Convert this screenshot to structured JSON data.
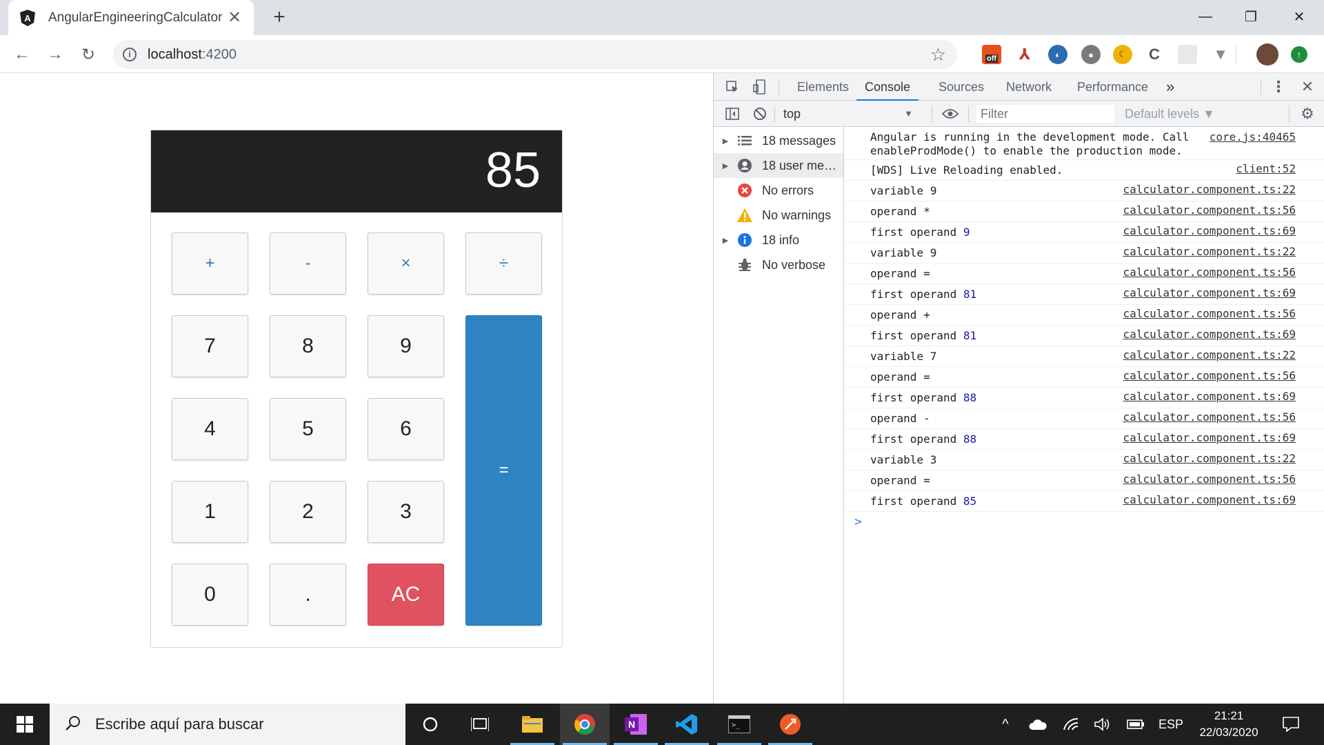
{
  "browser": {
    "tab_title": "AngularEngineeringCalculator",
    "url_host": "localhost",
    "url_port": ":4200",
    "extensions": [
      {
        "icon": "adblock-off-icon",
        "label": "off",
        "color": "#e8501a"
      },
      {
        "icon": "pdf-icon",
        "label": "",
        "color": "#c0392b"
      },
      {
        "icon": "opera-icon",
        "label": "",
        "color": "#2b6cb0"
      },
      {
        "icon": "tomato-icon",
        "label": "",
        "color": "#6b6b6b"
      },
      {
        "icon": "moon-icon",
        "label": "",
        "color": "#f0b400"
      },
      {
        "icon": "c-icon",
        "label": "",
        "color": "#555555"
      },
      {
        "icon": "blank-extension-icon",
        "label": "",
        "color": "#e0e0e0"
      },
      {
        "icon": "vee-icon",
        "label": "",
        "color": "#8a8a8a"
      }
    ]
  },
  "calculator": {
    "display": "85",
    "keys": {
      "plus": "+",
      "minus": "-",
      "times": "×",
      "divide": "÷",
      "k7": "7",
      "k8": "8",
      "k9": "9",
      "k4": "4",
      "k5": "5",
      "k6": "6",
      "k1": "1",
      "k2": "2",
      "k3": "3",
      "k0": "0",
      "dot": ".",
      "ac": "AC",
      "equals": "="
    }
  },
  "devtools": {
    "tabs": [
      "Elements",
      "Console",
      "Sources",
      "Network",
      "Performance"
    ],
    "more": "»",
    "context": "top",
    "filter_placeholder": "Filter",
    "levels": "Default levels ▼",
    "sidebar": [
      {
        "label": "18 messages",
        "icon": "list-icon",
        "expandable": true
      },
      {
        "label": "18 user mes...",
        "icon": "user-icon",
        "expandable": true
      },
      {
        "label": "No errors",
        "icon": "error-icon",
        "expandable": false
      },
      {
        "label": "No warnings",
        "icon": "warning-icon",
        "expandable": false
      },
      {
        "label": "18 info",
        "icon": "info-icon",
        "expandable": true
      },
      {
        "label": "No verbose",
        "icon": "bug-icon",
        "expandable": false
      }
    ],
    "messages": [
      {
        "line1": "Angular is running in the development mode. Call",
        "line2": "enableProdMode() to enable the production mode.",
        "num": "",
        "source": "core.js:40465"
      },
      {
        "line1": "[WDS] Live Reloading enabled.",
        "line2": "",
        "num": "",
        "source": "client:52"
      },
      {
        "line1": "variable 9",
        "line2": "",
        "num": "",
        "source": "calculator.component.ts:22"
      },
      {
        "line1": "operand *",
        "line2": "",
        "num": "",
        "source": "calculator.component.ts:56"
      },
      {
        "line1": "first operand ",
        "line2": "",
        "num": "9",
        "source": "calculator.component.ts:69"
      },
      {
        "line1": "variable 9",
        "line2": "",
        "num": "",
        "source": "calculator.component.ts:22"
      },
      {
        "line1": "operand =",
        "line2": "",
        "num": "",
        "source": "calculator.component.ts:56"
      },
      {
        "line1": "first operand ",
        "line2": "",
        "num": "81",
        "source": "calculator.component.ts:69"
      },
      {
        "line1": "operand +",
        "line2": "",
        "num": "",
        "source": "calculator.component.ts:56"
      },
      {
        "line1": "first operand ",
        "line2": "",
        "num": "81",
        "source": "calculator.component.ts:69"
      },
      {
        "line1": "variable 7",
        "line2": "",
        "num": "",
        "source": "calculator.component.ts:22"
      },
      {
        "line1": "operand =",
        "line2": "",
        "num": "",
        "source": "calculator.component.ts:56"
      },
      {
        "line1": "first operand ",
        "line2": "",
        "num": "88",
        "source": "calculator.component.ts:69"
      },
      {
        "line1": "operand -",
        "line2": "",
        "num": "",
        "source": "calculator.component.ts:56"
      },
      {
        "line1": "first operand ",
        "line2": "",
        "num": "88",
        "source": "calculator.component.ts:69"
      },
      {
        "line1": "variable 3",
        "line2": "",
        "num": "",
        "source": "calculator.component.ts:22"
      },
      {
        "line1": "operand =",
        "line2": "",
        "num": "",
        "source": "calculator.component.ts:56"
      },
      {
        "line1": "first operand ",
        "line2": "",
        "num": "85",
        "source": "calculator.component.ts:69"
      }
    ],
    "prompt": ">"
  },
  "taskbar": {
    "search_placeholder": "Escribe aquí para buscar",
    "language": "ESP",
    "time": "21:21",
    "date": "22/03/2020"
  }
}
